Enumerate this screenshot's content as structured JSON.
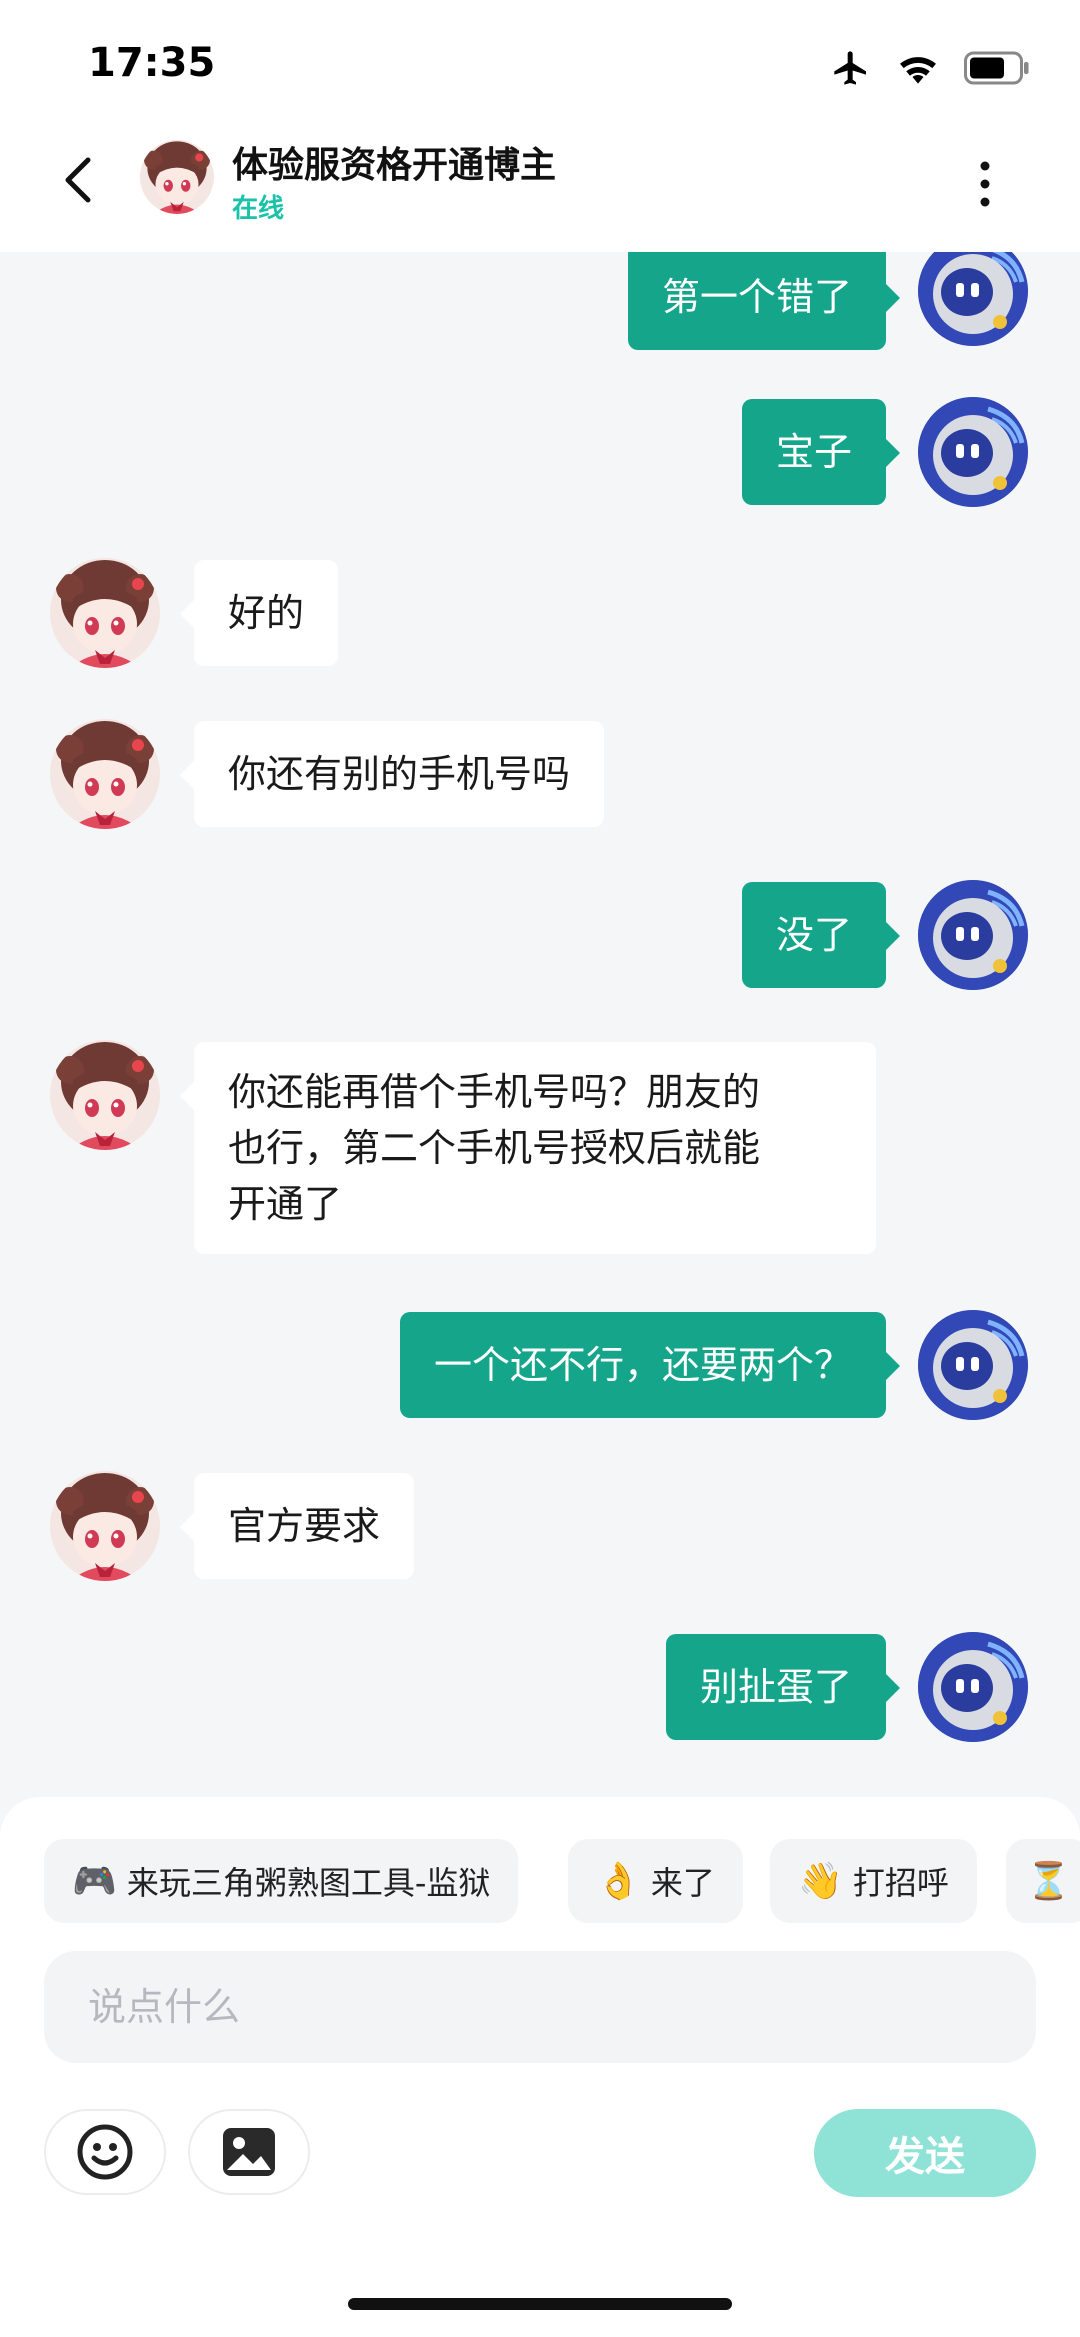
{
  "status_bar": {
    "time": "17:35"
  },
  "header": {
    "title": "体验服资格开通博主",
    "status": "在线"
  },
  "messages": [
    {
      "from": "me",
      "text": "第一个错了"
    },
    {
      "from": "me",
      "text": "宝子"
    },
    {
      "from": "peer",
      "text": "好的"
    },
    {
      "from": "peer",
      "text": "你还有别的手机号吗"
    },
    {
      "from": "me",
      "text": "没了"
    },
    {
      "from": "peer",
      "lines": [
        "你还能再借个手机号吗？朋友的",
        "也行，第二个手机号授权后就能",
        "开通了"
      ]
    },
    {
      "from": "me",
      "text": "一个还不行，还要两个？"
    },
    {
      "from": "peer",
      "text": "官方要求"
    },
    {
      "from": "me",
      "text": "别扯蛋了"
    }
  ],
  "quick_replies": [
    {
      "icon": "🎮",
      "label": "来玩三角粥熟图工具-监狱"
    },
    {
      "icon": "👌",
      "label": "来了"
    },
    {
      "icon": "👋",
      "label": "打招呼"
    },
    {
      "icon": "⏳",
      "label": ""
    }
  ],
  "input": {
    "placeholder": "说点什么",
    "value": ""
  },
  "send_label": "发送",
  "colors": {
    "accent": "#14a58a",
    "online": "#19c2a8",
    "send_disabled": "#8fe3d6",
    "background": "#f5f6f8"
  }
}
